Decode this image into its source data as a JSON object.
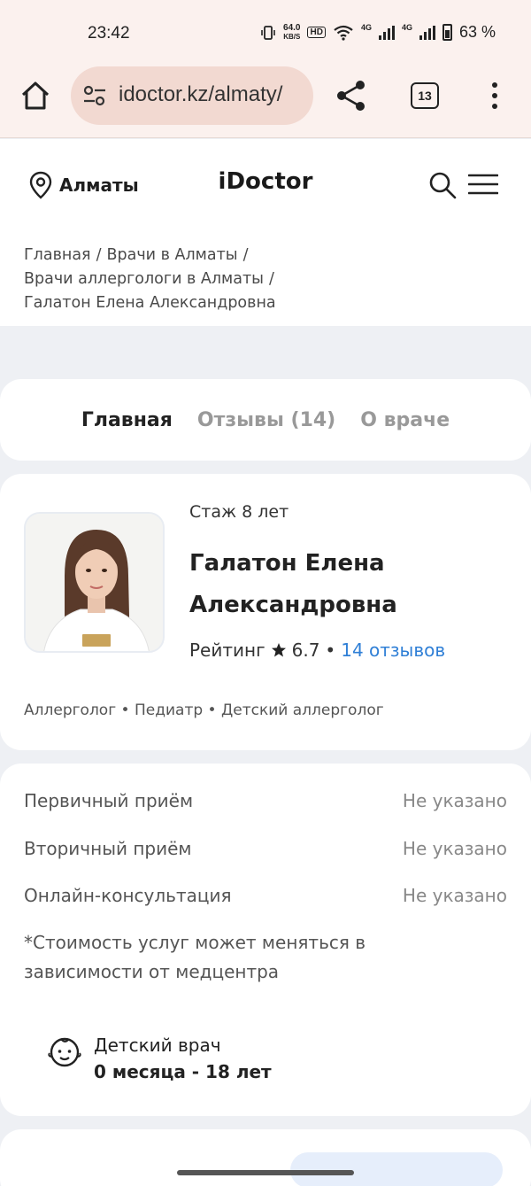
{
  "status_bar": {
    "time": "23:42",
    "net_speed_value": "64.0",
    "net_speed_unit": "KB/S",
    "hd_badge": "HD",
    "network_1": "4G",
    "network_2": "4G",
    "battery": "63 %"
  },
  "browser": {
    "url": "idoctor.kz/almaty/",
    "tab_count": "13"
  },
  "site_header": {
    "city": "Алматы",
    "logo": "iDoctor"
  },
  "breadcrumb": {
    "items": [
      "Главная",
      "Врачи в Алматы",
      "Врачи аллергологи в Алматы",
      "Галатон Елена Александровна"
    ]
  },
  "tabs": {
    "items": [
      "Главная",
      "Отзывы (14)",
      "О враче"
    ],
    "active": "Главная"
  },
  "doctor": {
    "experience": "Стаж 8 лет",
    "name_line1": "Галатон Елена",
    "name_line2": "Александровна",
    "rating_label": "Рейтинг",
    "rating_value": "6.7",
    "reviews_link": "14 отзывов",
    "specialties": "Аллерголог • Педиатр • Детский аллерголог"
  },
  "prices": {
    "rows": [
      {
        "label": "Первичный приём",
        "value": "Не указано"
      },
      {
        "label": "Вторичный приём",
        "value": "Не указано"
      },
      {
        "label": "Онлайн-консультация",
        "value": "Не указано"
      }
    ],
    "note": "*Стоимость услуг может меняться в зависимости от медцентра"
  },
  "kids": {
    "title": "Детский врач",
    "age_range": "0 месяца - 18 лет"
  },
  "colors": {
    "accent_link": "#2f7fd6",
    "chrome_bg": "#fbf1ee",
    "urlbar_bg": "#f2d9d1",
    "page_bg": "#eef0f4"
  }
}
